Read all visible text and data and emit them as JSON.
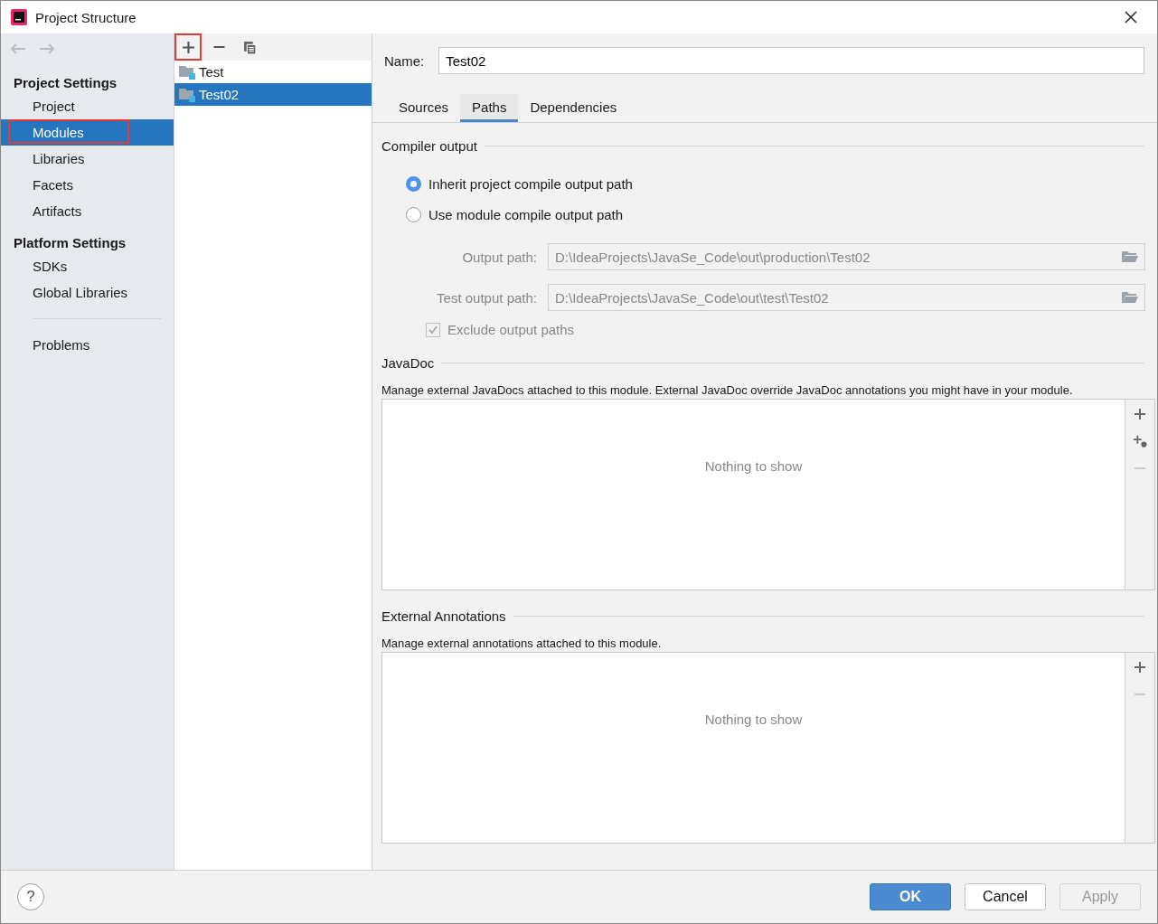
{
  "window": {
    "title": "Project Structure"
  },
  "sidebar": {
    "groups": [
      {
        "heading": "Project Settings",
        "items": [
          {
            "label": "Project",
            "selected": false,
            "highlighted": false
          },
          {
            "label": "Modules",
            "selected": true,
            "highlighted": true
          },
          {
            "label": "Libraries",
            "selected": false,
            "highlighted": false
          },
          {
            "label": "Facets",
            "selected": false,
            "highlighted": false
          },
          {
            "label": "Artifacts",
            "selected": false,
            "highlighted": false
          }
        ]
      },
      {
        "heading": "Platform Settings",
        "items": [
          {
            "label": "SDKs",
            "selected": false,
            "highlighted": false
          },
          {
            "label": "Global Libraries",
            "selected": false,
            "highlighted": false
          }
        ]
      },
      {
        "items": [
          {
            "label": "Problems",
            "selected": false,
            "highlighted": false
          }
        ]
      }
    ]
  },
  "toolbar": [
    {
      "kind": "add",
      "highlighted": true
    },
    {
      "kind": "remove",
      "highlighted": false
    },
    {
      "kind": "copy",
      "highlighted": false
    }
  ],
  "modules": [
    {
      "name": "Test",
      "selected": false
    },
    {
      "name": "Test02",
      "selected": true
    }
  ],
  "name_field": {
    "label": "Name:",
    "value": "Test02"
  },
  "tabs": [
    {
      "label": "Sources",
      "selected": false
    },
    {
      "label": "Paths",
      "selected": true
    },
    {
      "label": "Dependencies",
      "selected": false
    }
  ],
  "compiler_output": {
    "title": "Compiler output",
    "options": [
      {
        "label": "Inherit project compile output path",
        "selected": true
      },
      {
        "label": "Use module compile output path",
        "selected": false
      }
    ],
    "fields": [
      {
        "label": "Output path:",
        "value": "D:\\IdeaProjects\\JavaSe_Code\\out\\production\\Test02",
        "disabled": true
      },
      {
        "label": "Test output path:",
        "value": "D:\\IdeaProjects\\JavaSe_Code\\out\\test\\Test02",
        "disabled": true
      }
    ],
    "exclude": {
      "label": "Exclude output paths",
      "checked": true,
      "disabled": true
    }
  },
  "sections": [
    {
      "title": "JavaDoc",
      "description": "Manage external JavaDocs attached to this module. External JavaDoc override JavaDoc annotations you might have in your module.",
      "empty_text": "Nothing to show",
      "actions": [
        {
          "kind": "add",
          "disabled": false
        },
        {
          "kind": "add-web",
          "disabled": false
        },
        {
          "kind": "remove",
          "disabled": true
        }
      ]
    },
    {
      "title": "External Annotations",
      "description": "Manage external annotations attached to this module.",
      "empty_text": "Nothing to show",
      "actions": [
        {
          "kind": "add",
          "disabled": false
        },
        {
          "kind": "remove",
          "disabled": true
        }
      ]
    }
  ],
  "footer": {
    "help": "?",
    "buttons": [
      {
        "label": "OK",
        "kind": "primary",
        "disabled": false
      },
      {
        "label": "Cancel",
        "kind": "normal",
        "disabled": false
      },
      {
        "label": "Apply",
        "kind": "normal",
        "disabled": true
      }
    ]
  }
}
